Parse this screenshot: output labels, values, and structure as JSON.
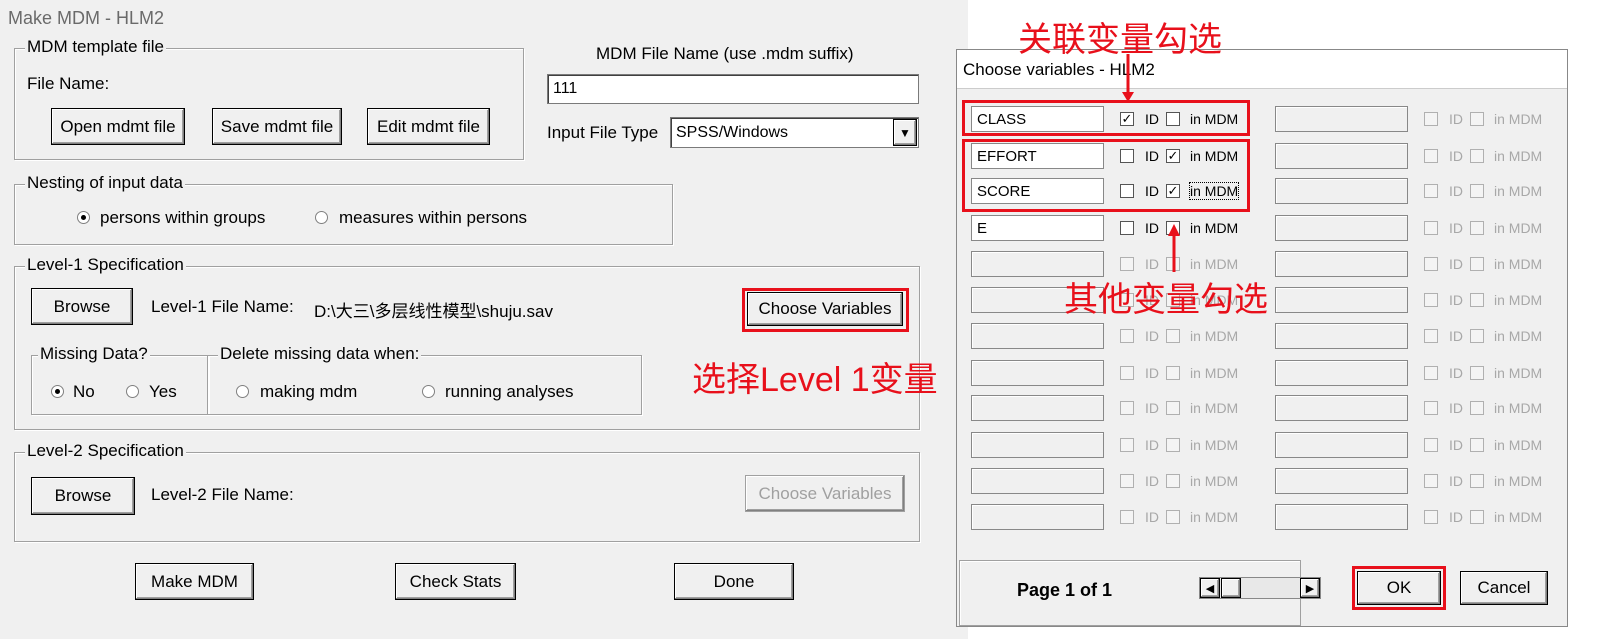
{
  "main": {
    "title": "Make MDM - HLM2",
    "template": {
      "legend": "MDM template file",
      "file_name_label": "File Name:",
      "open_btn": "Open mdmt file",
      "save_btn": "Save mdmt file",
      "edit_btn": "Edit mdmt file"
    },
    "mdm_name_label": "MDM File Name (use .mdm suffix)",
    "mdm_name_value": "111",
    "input_type_label": "Input File Type",
    "input_type_value": "SPSS/Windows",
    "nesting": {
      "legend": "Nesting of input data",
      "opt1": "persons within groups",
      "opt2": "measures within persons"
    },
    "level1": {
      "legend": "Level-1 Specification",
      "browse": "Browse",
      "file_label": "Level-1 File Name:",
      "file_path": "D:\\大三\\多层线性模型\\shuju.sav",
      "choose_btn": "Choose Variables",
      "missing_legend": "Missing Data?",
      "no": "No",
      "yes": "Yes",
      "delete_legend": "Delete missing data when:",
      "making": "making mdm",
      "running": "running analyses"
    },
    "level2": {
      "legend": "Level-2 Specification",
      "browse": "Browse",
      "file_label": "Level-2 File Name:",
      "choose_btn": "Choose Variables"
    },
    "make_btn": "Make MDM",
    "check_btn": "Check Stats",
    "done_btn": "Done"
  },
  "dialog": {
    "title": "Choose variables - HLM2",
    "id_label": "ID",
    "mdm_label": "in MDM",
    "variables": [
      "CLASS",
      "EFFORT",
      "SCORE",
      "E",
      "",
      "",
      "",
      "",
      "",
      "",
      "",
      ""
    ],
    "page_label": "Page 1 of 1",
    "ok": "OK",
    "cancel": "Cancel"
  },
  "annotations": {
    "link_var": "关联变量勾选",
    "other_vars": "其他变量勾选",
    "select_level1": "选择Level 1变量"
  },
  "colors": {
    "annotation_red": "#e8101b",
    "window_bg": "#f0f0f0"
  }
}
